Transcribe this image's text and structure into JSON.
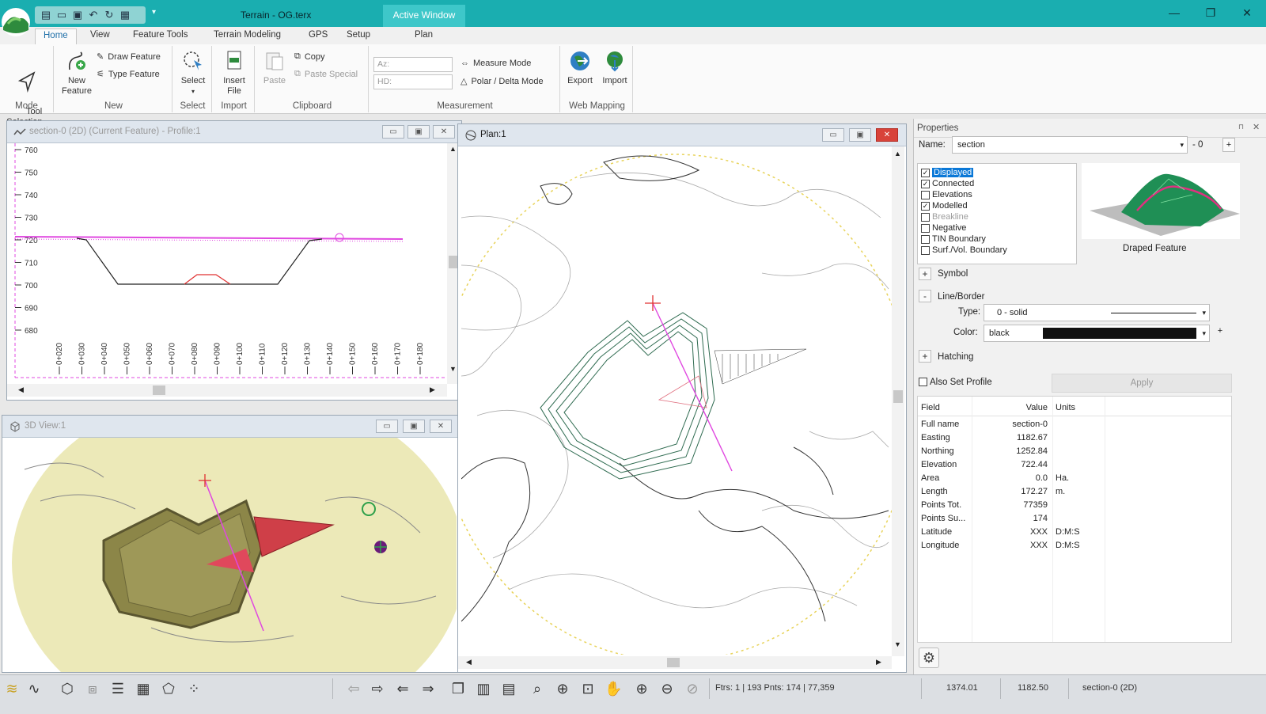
{
  "app": {
    "title": "Terrain - OG.terx",
    "context_tab": "Active Window",
    "context_subtab": "Plan",
    "tabs": [
      "Home",
      "View",
      "Feature Tools",
      "Terrain Modeling",
      "GPS",
      "Setup"
    ]
  },
  "ribbon": {
    "mode": {
      "label": "Mode",
      "tool_selection": "Tool\nSelection"
    },
    "new": {
      "label": "New",
      "new_feature_1": "New",
      "new_feature_2": "Feature",
      "draw_feature": "Draw Feature",
      "type_feature": "Type Feature"
    },
    "select": {
      "label": "Select",
      "select_btn": "Select"
    },
    "import": {
      "label": "Import",
      "insert_1": "Insert",
      "insert_2": "File"
    },
    "clipboard": {
      "label": "Clipboard",
      "paste": "Paste",
      "copy": "Copy",
      "paste_special": "Paste Special"
    },
    "measurement": {
      "label": "Measurement",
      "az_placeholder": "Az:",
      "hd_placeholder": "HD:",
      "measure_mode": "Measure Mode",
      "polar_delta": "Polar / Delta Mode"
    },
    "web_mapping": {
      "label": "Web Mapping",
      "export": "Export",
      "import": "Import"
    }
  },
  "profile": {
    "title": "section-0 (2D) (Current Feature) - Profile:1",
    "y_ticks": [
      "760",
      "750",
      "740",
      "730",
      "720",
      "710",
      "700",
      "690",
      "680"
    ],
    "x_ticks": [
      "0+020",
      "0+030",
      "0+040",
      "0+050",
      "0+060",
      "0+070",
      "0+080",
      "0+090",
      "0+100",
      "0+110",
      "0+120",
      "0+130",
      "0+140",
      "0+150",
      "0+160",
      "0+170",
      "0+180"
    ]
  },
  "view3d": {
    "title": "3D View:1"
  },
  "plan": {
    "title": "Plan:1"
  },
  "properties": {
    "header": "Properties",
    "name_label": "Name:",
    "name_value": "section",
    "name_suffix": "- 0",
    "flags": [
      {
        "label": "Displayed",
        "checked": true,
        "selected": true,
        "dim": false
      },
      {
        "label": "Connected",
        "checked": true,
        "selected": false,
        "dim": false
      },
      {
        "label": "Elevations",
        "checked": false,
        "selected": false,
        "dim": false
      },
      {
        "label": "Modelled",
        "checked": true,
        "selected": false,
        "dim": false
      },
      {
        "label": "Breakline",
        "checked": false,
        "selected": false,
        "dim": true
      },
      {
        "label": "Negative",
        "checked": false,
        "selected": false,
        "dim": false
      },
      {
        "label": "TIN Boundary",
        "checked": false,
        "selected": false,
        "dim": false
      },
      {
        "label": "Surf./Vol. Boundary",
        "checked": false,
        "selected": false,
        "dim": false
      }
    ],
    "preview_caption": "Draped Feature",
    "symbol_label": "Symbol",
    "line_border_label": "Line/Border",
    "type_label": "Type:",
    "type_value": "0 - solid",
    "color_label": "Color:",
    "color_value": "black",
    "hatching_label": "Hatching",
    "also_set_profile": "Also Set Profile",
    "apply": "Apply",
    "grid_headers": {
      "field": "Field",
      "value": "Value",
      "units": "Units"
    },
    "rows": [
      {
        "field": "Full name",
        "value": "section-0",
        "units": ""
      },
      {
        "field": "Easting",
        "value": "1182.67",
        "units": ""
      },
      {
        "field": "Northing",
        "value": "1252.84",
        "units": ""
      },
      {
        "field": "Elevation",
        "value": "722.44",
        "units": ""
      },
      {
        "field": "Area",
        "value": "0.0",
        "units": "Ha."
      },
      {
        "field": "Length",
        "value": "172.27",
        "units": "m."
      },
      {
        "field": "Points Tot.",
        "value": "77359",
        "units": ""
      },
      {
        "field": "Points Su...",
        "value": "174",
        "units": ""
      },
      {
        "field": "Latitude",
        "value": "XXX",
        "units": "D:M:S"
      },
      {
        "field": "Longitude",
        "value": "XXX",
        "units": "D:M:S"
      }
    ]
  },
  "status": {
    "ftrs": "Ftrs: 1 | 193  Pnts: 174 | 77,359",
    "x": "1374.01",
    "y": "1182.50",
    "feature": "section-0 (2D)"
  },
  "colors": {
    "titlebar": "#1aaeb0",
    "accent": "#0a78d7",
    "profile_line": "#e048e0",
    "view3d_bg": "#ece9b8"
  }
}
